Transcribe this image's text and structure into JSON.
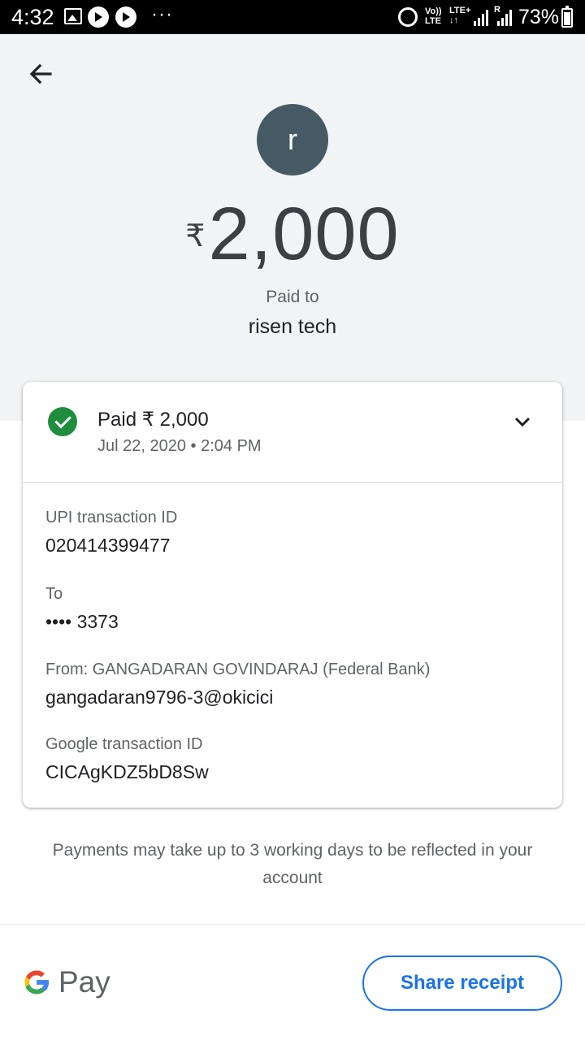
{
  "status_bar": {
    "time": "4:32",
    "overflow": "···",
    "volte": "Vo))\nLTE",
    "lte": "LTE+\n↓↑",
    "roaming": "R",
    "battery": "73%"
  },
  "header": {
    "avatar_letter": "r",
    "currency": "₹",
    "amount": "2,000",
    "paid_to_label": "Paid to",
    "payee_name": "risen tech"
  },
  "summary": {
    "status": "Paid ₹ 2,000",
    "datetime": "Jul 22, 2020 • 2:04 PM"
  },
  "details": {
    "upi_label": "UPI transaction ID",
    "upi_value": "020414399477",
    "to_label": "To",
    "to_value": "•••• 3373",
    "from_label": "From: GANGADARAN GOVINDARAJ (Federal Bank)",
    "from_value": "gangadaran9796-3@okicici",
    "google_label": "Google transaction ID",
    "google_value": "CICAgKDZ5bD8Sw"
  },
  "note": "Payments may take up to 3 working days to be reflected in your account",
  "footer": {
    "brand": "Pay",
    "share_label": "Share receipt"
  },
  "colors": {
    "accent": "#1a73e8",
    "success": "#1e8e3e",
    "avatar": "#455a64",
    "header_bg": "#f1f3f4"
  }
}
